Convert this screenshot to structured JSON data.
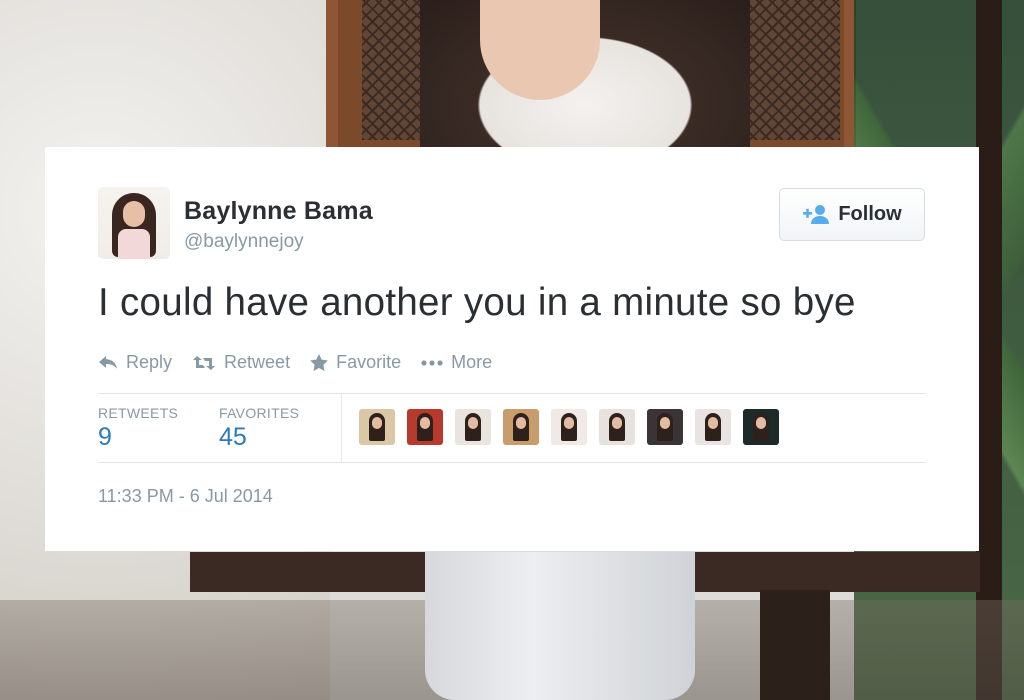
{
  "tweet": {
    "author_name": "Baylynne Bama",
    "author_handle": "@baylynnejoy",
    "follow_label": "Follow",
    "text": "I could have another you in a minute so bye",
    "actions": {
      "reply": "Reply",
      "retweet": "Retweet",
      "favorite": "Favorite",
      "more": "More"
    },
    "stats": {
      "retweets_label": "RETWEETS",
      "retweets_count": "9",
      "favorites_label": "FAVORITES",
      "favorites_count": "45"
    },
    "timestamp": "11:33 PM - 6 Jul 2014"
  },
  "icons": {
    "follow": "add-user-icon",
    "reply": "reply-arrow-icon",
    "retweet": "retweet-icon",
    "favorite": "star-icon",
    "more": "ellipsis-icon"
  },
  "colors": {
    "text": "#292f33",
    "muted": "#8899a6",
    "link": "#2b7bb9",
    "follow_icon": "#55acee",
    "divider": "#e1e8ed"
  },
  "favoriter_avatars": [
    {
      "bg": "#d9c7a6"
    },
    {
      "bg": "#b83a2c"
    },
    {
      "bg": "#eae4de"
    },
    {
      "bg": "#c99c6b"
    },
    {
      "bg": "#f1e9e6"
    },
    {
      "bg": "#e8e2de"
    },
    {
      "bg": "#3a3436"
    },
    {
      "bg": "#e9e4e2"
    },
    {
      "bg": "#1e2a2a"
    }
  ]
}
